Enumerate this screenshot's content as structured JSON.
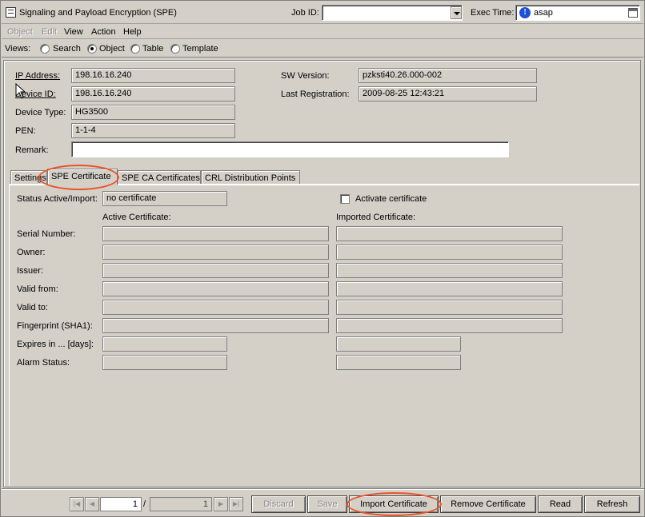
{
  "window": {
    "title": "Signaling and Payload Encryption (SPE)",
    "job_id_label": "Job ID:",
    "job_id_value": "",
    "exec_time_label": "Exec Time:",
    "exec_time_value": "asap"
  },
  "menu": {
    "items": [
      "Object",
      "Edit",
      "View",
      "Action",
      "Help"
    ]
  },
  "views": {
    "label": "Views:",
    "options": [
      "Search",
      "Object",
      "Table",
      "Template"
    ],
    "selected": "Object"
  },
  "device": {
    "ip_label": "IP Address:",
    "ip_value": "198.16.16.240",
    "device_id_label": "Device ID:",
    "device_id_value": "198.16.16.240",
    "device_type_label": "Device Type:",
    "device_type_value": "HG3500",
    "pen_label": "PEN:",
    "pen_value": "1-1-4",
    "remark_label": "Remark:",
    "remark_value": "",
    "sw_version_label": "SW Version:",
    "sw_version_value": "pzksti40.26.000-002",
    "last_registration_label": "Last Registration:",
    "last_registration_value": "2009-08-25 12:43:21"
  },
  "tabs": [
    {
      "label": "Settings"
    },
    {
      "label": "SPE Certificate"
    },
    {
      "label": "SPE CA Certificates"
    },
    {
      "label": "CRL Distribution Points"
    }
  ],
  "certificate": {
    "status_label": "Status Active/Import:",
    "status_value": "no certificate",
    "activate_label": "Activate certificate",
    "active_header": "Active Certificate:",
    "imported_header": "Imported Certificate:",
    "rows": [
      {
        "label": "Serial Number:",
        "active": "",
        "imported": ""
      },
      {
        "label": "Owner:",
        "active": "",
        "imported": ""
      },
      {
        "label": "Issuer:",
        "active": "",
        "imported": ""
      },
      {
        "label": "Valid from:",
        "active": "",
        "imported": ""
      },
      {
        "label": "Valid to:",
        "active": "",
        "imported": ""
      },
      {
        "label": "Fingerprint (SHA1):",
        "active": "",
        "imported": ""
      },
      {
        "label": "Expires in ... [days]:",
        "active": "",
        "imported": ""
      },
      {
        "label": "Alarm Status:",
        "active": "",
        "imported": ""
      }
    ]
  },
  "footer": {
    "page_current": "1",
    "page_sep": "/",
    "page_total": "1",
    "buttons": [
      "Discard",
      "Save",
      "Import Certificate",
      "Remove Certificate",
      "Read",
      "Refresh"
    ]
  }
}
